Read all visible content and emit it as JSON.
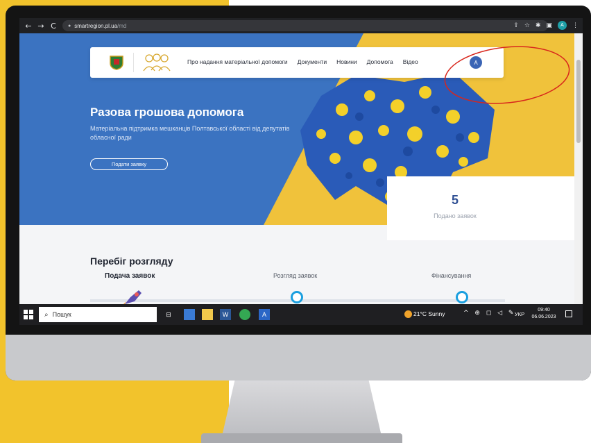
{
  "browser": {
    "back": "←",
    "forward": "→",
    "reload": "C",
    "url_host": "smartregion.pl.ua",
    "url_path": "/md",
    "profile_letter": "A"
  },
  "site": {
    "nav": [
      {
        "label": "Про надання матеріальної допомоги"
      },
      {
        "label": "Документи"
      },
      {
        "label": "Новини"
      },
      {
        "label": "Допомога"
      },
      {
        "label": "Відео"
      }
    ],
    "avatar_letter": "A",
    "hero": {
      "title": "Разова грошова допомога",
      "subtitle": "Матеріальна підтримка мешканців Полтавської області від депутатів обласної ради",
      "button": "Подати заявку"
    },
    "stats": {
      "count": "5",
      "label": "Подано заявок"
    },
    "progress": {
      "title": "Перебіг розгляду",
      "steps": [
        {
          "label": "Подача заявок"
        },
        {
          "label": "Розгляд заявок"
        },
        {
          "label": "Фінансування"
        }
      ]
    }
  },
  "taskbar": {
    "search_placeholder": "Пошук",
    "weather": "21°C  Sunny",
    "language": "УКР",
    "time": "09:40",
    "date": "06.06.2023"
  },
  "colors": {
    "hero_blue": "#3b73c1",
    "hero_yellow": "#f0c23b",
    "accent": "#2f4f93",
    "annotation": "#d8261c"
  }
}
